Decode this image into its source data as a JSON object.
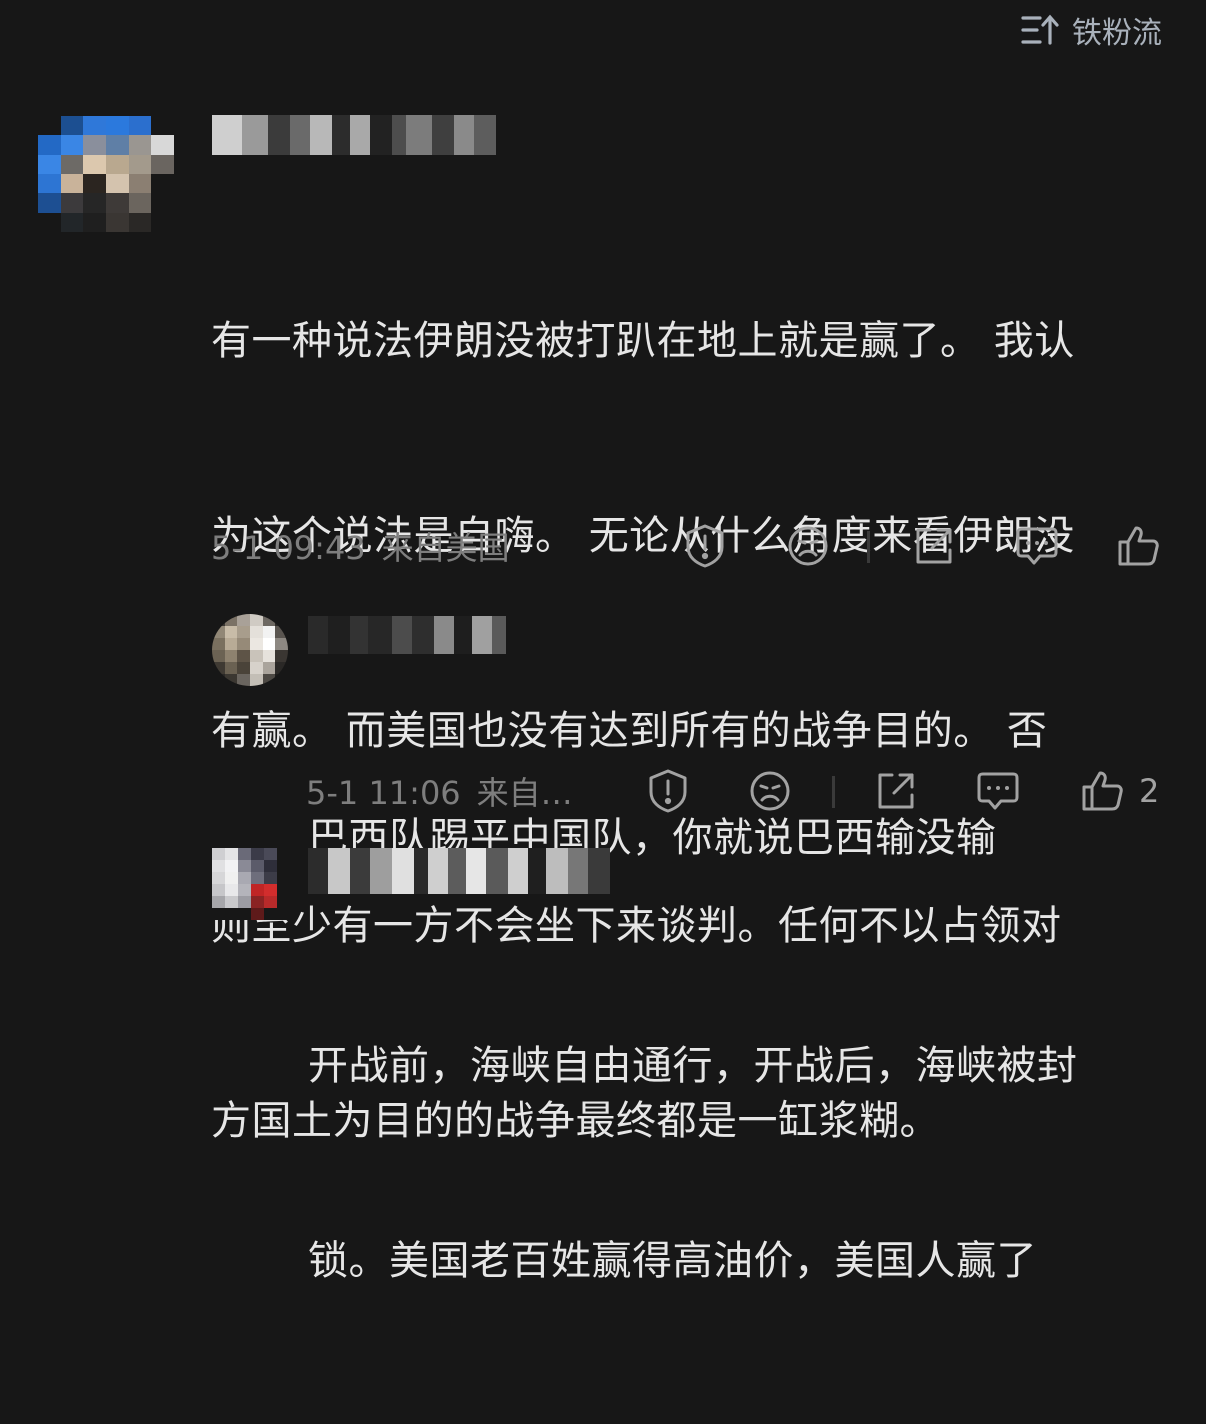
{
  "header": {
    "sort_label": "铁粉流",
    "sort_icon": "sort-up-icon"
  },
  "comments": [
    {
      "text_lines": [
        "有一种说法伊朗没被打趴在地上就是赢了。 我认",
        "为这个说法是自嗨。 无论从什么角度来看伊朗没",
        "有赢。 而美国也没有达到所有的战争目的。 否",
        "则至少有一方不会坐下来谈判。任何不以占领对",
        "方国土为目的的战争最终都是一缸浆糊。"
      ],
      "time": "5-1 09:43",
      "location": "来自美国",
      "likes": ""
    },
    {
      "text_lines": [
        "巴西队踢平中国队，你就说巴西输没输"
      ],
      "time": "5-1 11:06",
      "location": "来自…",
      "likes": "2"
    },
    {
      "text_lines": [
        "开战前，海峡自由通行，开战后，海峡被封",
        "锁。美国老百姓赢得高油价，美国人赢了"
      ]
    }
  ],
  "colors": {
    "background": "#171717",
    "text": "#e6e6e6",
    "meta": "#7e7e7e",
    "icon": "#a2a2a2",
    "sort": "#a9b1bb"
  },
  "icons": [
    "sort-up-icon",
    "report-icon",
    "dislike-icon",
    "share-icon",
    "reply-icon",
    "like-icon"
  ]
}
